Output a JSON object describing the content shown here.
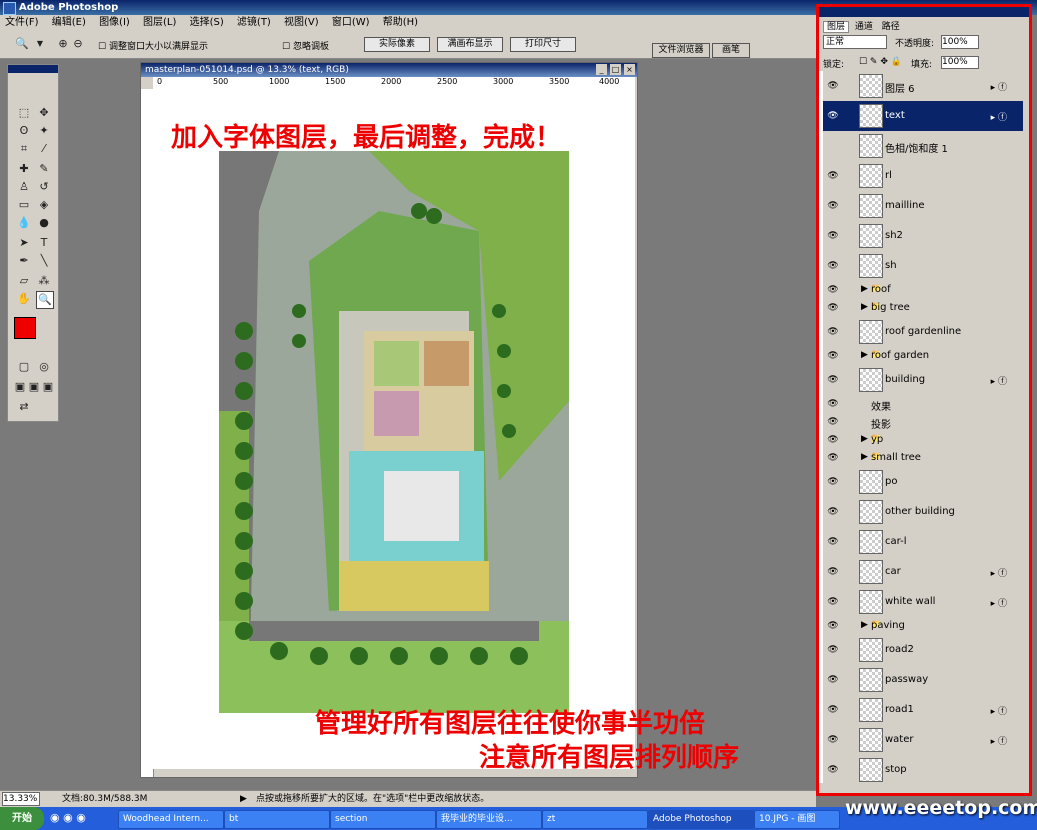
{
  "window": {
    "title": "Adobe Photoshop"
  },
  "menu": [
    "文件(F)",
    "编辑(E)",
    "图像(I)",
    "图层(L)",
    "选择(S)",
    "滤镜(T)",
    "视图(V)",
    "窗口(W)",
    "帮助(H)"
  ],
  "options": {
    "check1": "调整窗口大小以满屏显示",
    "check2": "忽略调板",
    "btn_actual": "实际像素",
    "btn_fit": "满画布显示",
    "btn_print": "打印尺寸",
    "tab_browser": "文件浏览器",
    "tab_brushes": "画笔"
  },
  "document": {
    "title": "masterplan-051014.psd @ 13.3% (text, RGB)",
    "ruler_ticks": [
      "0",
      "500",
      "1000",
      "1500",
      "2000",
      "2500",
      "3000",
      "3500",
      "4000"
    ]
  },
  "canvas_text": {
    "top": "加入字体图层，最后调整，完成！",
    "bottom1": "管理好所有图层往往使你事半功倍",
    "bottom2": "注意所有图层排列顺序"
  },
  "layers_panel": {
    "tabs": [
      "图层",
      "通道",
      "路径"
    ],
    "blend_mode": "正常",
    "opacity_label": "不透明度:",
    "opacity": "100%",
    "lock_label": "锁定:",
    "fill_label": "填充:",
    "fill": "100%",
    "layers": [
      {
        "name": "图层 6",
        "type": "layer",
        "fx": true
      },
      {
        "name": "text",
        "type": "layer",
        "fx": true,
        "selected": true
      },
      {
        "name": "色相/饱和度 1",
        "type": "adjust"
      },
      {
        "name": "rl",
        "type": "layer"
      },
      {
        "name": "mailline",
        "type": "layer"
      },
      {
        "name": "sh2",
        "type": "layer"
      },
      {
        "name": "sh",
        "type": "layer"
      },
      {
        "name": "roof",
        "type": "group"
      },
      {
        "name": "big tree",
        "type": "group"
      },
      {
        "name": "roof gardenline",
        "type": "layer"
      },
      {
        "name": "roof garden",
        "type": "group"
      },
      {
        "name": "building",
        "type": "layer",
        "fx": true
      },
      {
        "name": "效果",
        "type": "effect"
      },
      {
        "name": "投影",
        "type": "effect"
      },
      {
        "name": "yp",
        "type": "group"
      },
      {
        "name": "small tree",
        "type": "group"
      },
      {
        "name": "po",
        "type": "layer"
      },
      {
        "name": "other building",
        "type": "layer"
      },
      {
        "name": "car-l",
        "type": "layer"
      },
      {
        "name": "car",
        "type": "layer",
        "fx": true
      },
      {
        "name": "white wall",
        "type": "layer",
        "fx": true
      },
      {
        "name": "paving",
        "type": "group"
      },
      {
        "name": "road2",
        "type": "layer"
      },
      {
        "name": "passway",
        "type": "layer"
      },
      {
        "name": "road1",
        "type": "layer",
        "fx": true
      },
      {
        "name": "water",
        "type": "layer",
        "fx": true
      },
      {
        "name": "stop",
        "type": "layer"
      }
    ]
  },
  "status": {
    "zoom": "13.33%",
    "doc": "文档:80.3M/588.3M",
    "hint": "点按或拖移所要扩大的区域。在\"选项\"栏中更改缩放状态。"
  },
  "taskbar": {
    "start": "开始",
    "tasks": [
      "Woodhead Intern...",
      "bt",
      "section",
      "我毕业的毕业设...",
      "zt",
      "Adobe Photoshop",
      "10.JPG - 画图"
    ]
  },
  "watermark": "www.eeeetop.com"
}
